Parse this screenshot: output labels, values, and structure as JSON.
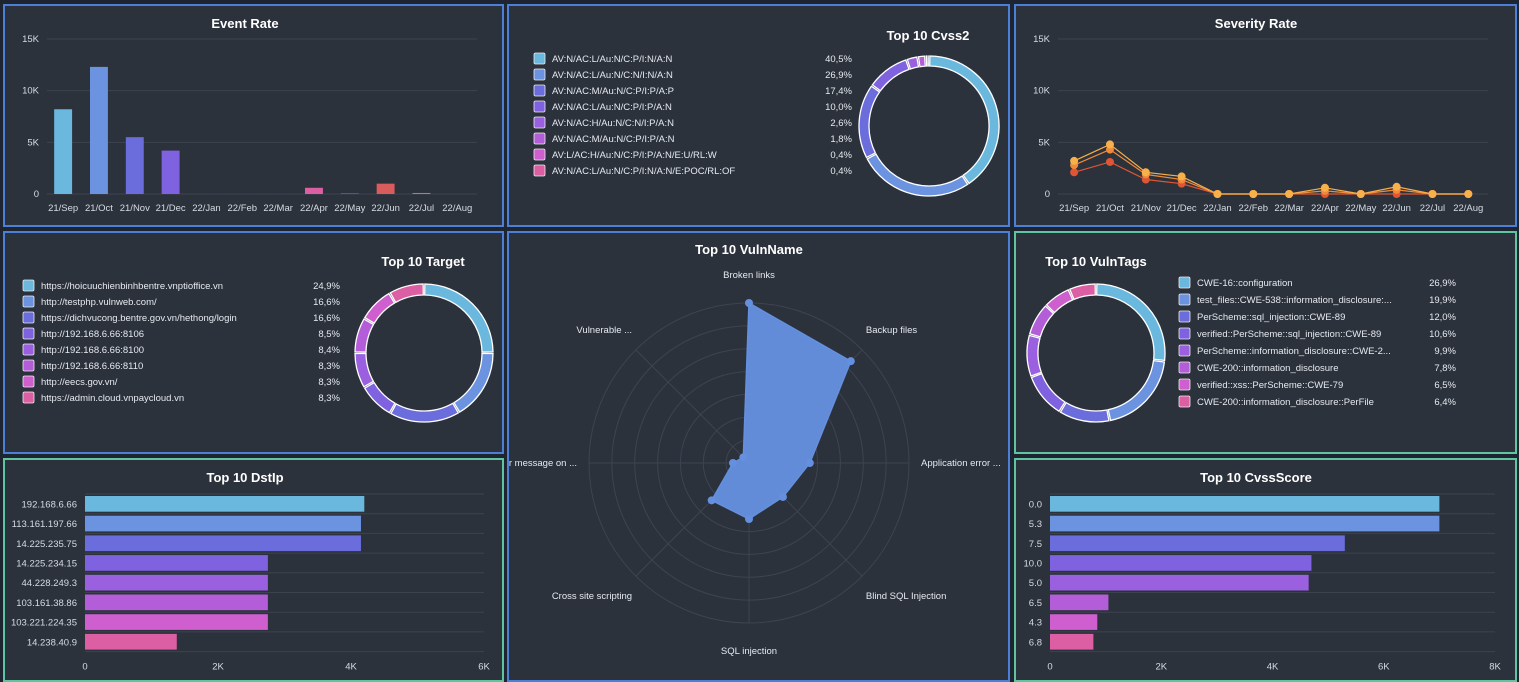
{
  "colors": {
    "seq": [
      "#6ab8de",
      "#6b93e0",
      "#6a6ddb",
      "#7f62df",
      "#9a60e0",
      "#b35ed8",
      "#cf5ecf",
      "#dd5fa3"
    ],
    "grid": "#3c434f",
    "panel": "#2c323c"
  },
  "event_rate": {
    "title": "Event Rate",
    "chart_data": {
      "type": "bar",
      "categories": [
        "21/Sep",
        "21/Oct",
        "21/Nov",
        "21/Dec",
        "22/Jan",
        "22/Feb",
        "22/Mar",
        "22/Apr",
        "22/May",
        "22/Jun",
        "22/Jul",
        "22/Aug"
      ],
      "values": [
        8200,
        12300,
        5500,
        4200,
        0,
        0,
        0,
        600,
        50,
        1000,
        100,
        0
      ],
      "bar_colors": [
        "#6ab8de",
        "#6b93e0",
        "#6a6ddb",
        "#7f62df",
        "#9a60e0",
        "#b35ed8",
        "#cf5ecf",
        "#dd5fa3",
        "#d9577d",
        "#d95c5c",
        "#d96c5a",
        "#d98a5a"
      ],
      "ylim": [
        0,
        15000
      ],
      "yticks": [
        "0",
        "5K",
        "10K",
        "15K"
      ]
    }
  },
  "cvss2": {
    "title": "Top 10 Cvss2",
    "chart_data": {
      "type": "pie",
      "labels": [
        "AV:N/AC:L/Au:N/C:P/I:N/A:N",
        "AV:N/AC:L/Au:N/C:N/I:N/A:N",
        "AV:N/AC:M/Au:N/C:P/I:P/A:P",
        "AV:N/AC:L/Au:N/C:P/I:P/A:N",
        "AV:N/AC:H/Au:N/C:N/I:P/A:N",
        "AV:N/AC:M/Au:N/C:P/I:P/A:N",
        "AV:L/AC:H/Au:N/C:P/I:P/A:N/E:U/RL:W",
        "AV:N/AC:L/Au:N/C:P/I:N/A:N/E:POC/RL:OF"
      ],
      "percents": [
        "40,5%",
        "26,9%",
        "17,4%",
        "10,0%",
        "2,6%",
        "1,8%",
        "0,4%",
        "0,4%"
      ],
      "values": [
        40.5,
        26.9,
        17.4,
        10.0,
        2.6,
        1.8,
        0.4,
        0.4
      ]
    }
  },
  "severity_rate": {
    "title": "Severity Rate",
    "chart_data": {
      "type": "line",
      "x": [
        "21/Sep",
        "21/Oct",
        "21/Nov",
        "21/Dec",
        "22/Jan",
        "22/Feb",
        "22/Mar",
        "22/Apr",
        "22/May",
        "22/Jun",
        "22/Jul",
        "22/Aug"
      ],
      "series": [
        {
          "values": [
            3200,
            4800,
            2100,
            1700,
            0,
            0,
            0,
            600,
            0,
            700,
            0,
            0
          ],
          "color": "#f7b04a"
        },
        {
          "values": [
            2800,
            4300,
            1900,
            1400,
            0,
            0,
            0,
            300,
            0,
            400,
            0,
            0
          ],
          "color": "#f08a3a"
        },
        {
          "values": [
            2100,
            3100,
            1400,
            1000,
            0,
            0,
            0,
            0,
            0,
            0,
            0,
            0
          ],
          "color": "#e05533"
        }
      ],
      "ylim": [
        0,
        15000
      ],
      "yticks": [
        "0",
        "5K",
        "10K",
        "15K"
      ]
    }
  },
  "target": {
    "title": "Top 10 Target",
    "chart_data": {
      "type": "pie",
      "labels": [
        "https://hoicuuchienbinhbentre.vnptioffice.vn",
        "http://testphp.vulnweb.com/",
        "https://dichvucong.bentre.gov.vn/hethong/login",
        "http://192.168.6.66:8106",
        "http://192.168.6.66:8100",
        "http://192.168.6.66:8110",
        "http://eecs.gov.vn/",
        "https://admin.cloud.vnpaycloud.vn"
      ],
      "percents": [
        "24,9%",
        "16,6%",
        "16,6%",
        "8,5%",
        "8,4%",
        "8,3%",
        "8,3%",
        "8,3%"
      ],
      "values": [
        24.9,
        16.6,
        16.6,
        8.5,
        8.4,
        8.3,
        8.3,
        8.3
      ]
    }
  },
  "vulnname": {
    "title": "Top 10 VulnName",
    "chart_data": {
      "type": "radar",
      "axes": [
        "Broken links",
        "Backup files",
        "Application error ...",
        "Blind SQL Injection",
        "SQL injection",
        "Cross site scripting",
        "or message on ...",
        "Vulnerable ..."
      ],
      "values": [
        100,
        90,
        38,
        30,
        35,
        33,
        10,
        5
      ],
      "rmax": 100
    }
  },
  "vulntags": {
    "title": "Top 10 VulnTags",
    "chart_data": {
      "type": "pie",
      "labels": [
        "CWE-16::configuration",
        "test_files::CWE-538::information_disclosure:...",
        "PerScheme::sql_injection::CWE-89",
        "verified::PerScheme::sql_injection::CWE-89",
        "PerScheme::information_disclosure::CWE-2...",
        "CWE-200::information_disclosure",
        "verified::xss::PerScheme::CWE-79",
        "CWE-200::information_disclosure::PerFile"
      ],
      "percents": [
        "26,9%",
        "19,9%",
        "12,0%",
        "10,6%",
        "9,9%",
        "7,8%",
        "6,5%",
        "6,4%"
      ],
      "values": [
        26.9,
        19.9,
        12.0,
        10.6,
        9.9,
        7.8,
        6.5,
        6.4
      ]
    }
  },
  "dstip": {
    "title": "Top 10 DstIp",
    "chart_data": {
      "type": "bar",
      "orientation": "horizontal",
      "categories": [
        "192.168.6.66",
        "113.161.197.66",
        "14.225.235.75",
        "14.225.234.15",
        "44.228.249.3",
        "103.161.38.86",
        "103.221.224.35",
        "14.238.40.9"
      ],
      "values": [
        4200,
        4150,
        4150,
        2750,
        2750,
        2750,
        2750,
        1380
      ],
      "xlim": [
        0,
        6000
      ],
      "xticks": [
        "0",
        "2K",
        "4K",
        "6K"
      ]
    }
  },
  "cvssscore": {
    "title": "Top 10 CvssScore",
    "chart_data": {
      "type": "bar",
      "orientation": "horizontal",
      "categories": [
        "0.0",
        "5.3",
        "7.5",
        "10.0",
        "5.0",
        "6.5",
        "4.3",
        "6.8"
      ],
      "values": [
        7000,
        7000,
        5300,
        4700,
        4650,
        1050,
        850,
        780
      ],
      "xlim": [
        0,
        8000
      ],
      "xticks": [
        "0",
        "2K",
        "4K",
        "6K",
        "8K"
      ]
    }
  }
}
